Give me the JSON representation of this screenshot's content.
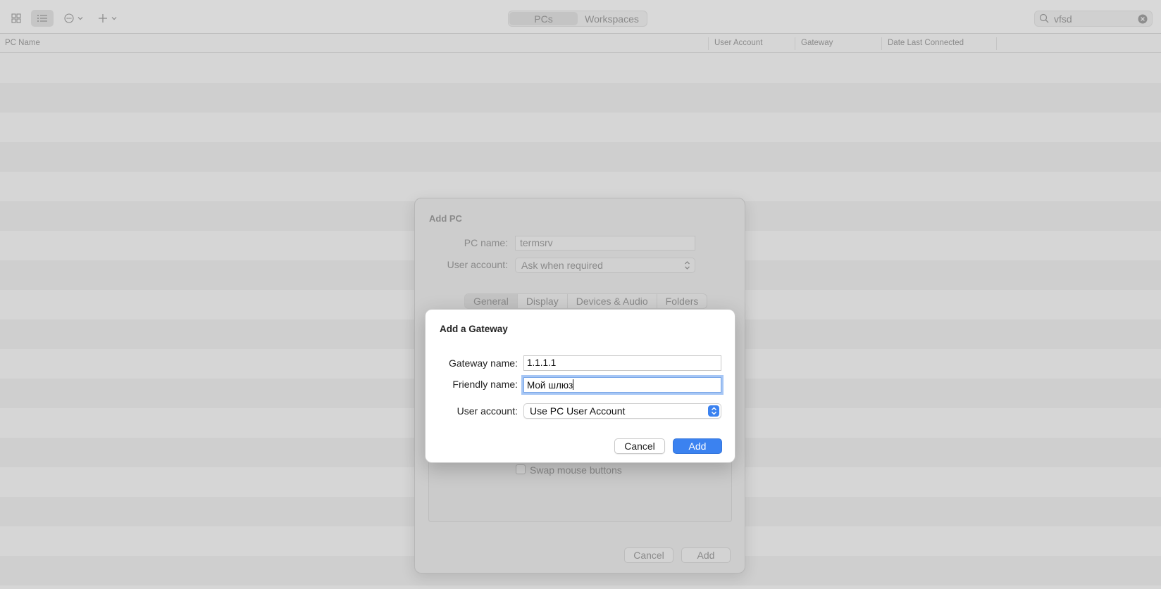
{
  "toolbar": {
    "icons": [
      "grid-view-icon",
      "list-view-icon",
      "more-options-icon",
      "add-icon"
    ],
    "segments": [
      "PCs",
      "Workspaces"
    ],
    "selected_segment": "PCs",
    "search_value": "vfsd"
  },
  "columns": [
    "PC Name",
    "User Account",
    "Gateway",
    "Date Last Connected"
  ],
  "add_pc": {
    "title": "Add PC",
    "pc_name_label": "PC name:",
    "pc_name_value": "termsrv",
    "user_account_label": "User account:",
    "user_account_value": "Ask when required",
    "tabs": [
      "General",
      "Display",
      "Devices & Audio",
      "Folders"
    ],
    "selected_tab": "General",
    "swap_mouse_label": "Swap mouse buttons",
    "cancel_label": "Cancel",
    "add_label": "Add"
  },
  "add_gateway": {
    "title": "Add a Gateway",
    "gateway_name_label": "Gateway name:",
    "gateway_name_value": "1.1.1.1",
    "friendly_name_label": "Friendly name:",
    "friendly_name_value": "Мой шлюз",
    "user_account_label": "User account:",
    "user_account_value": "Use PC User Account",
    "cancel_label": "Cancel",
    "add_label": "Add"
  },
  "colors": {
    "accent": "#3b82f0",
    "focus_ring": "#a6c6f5"
  }
}
